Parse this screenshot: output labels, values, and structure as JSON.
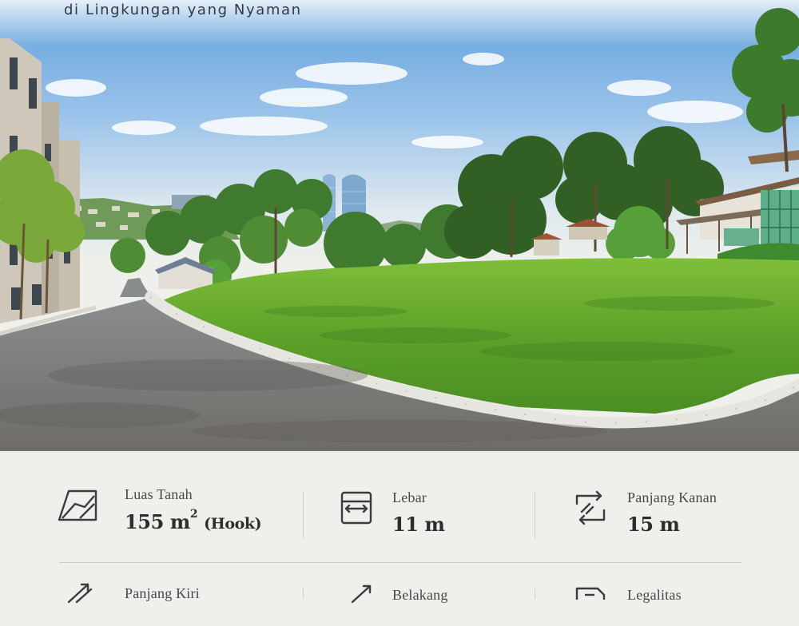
{
  "hero": {
    "subtitle": "di Lingkungan yang Nyaman",
    "illustration": "suburban-land-plot"
  },
  "specs": {
    "items": [
      {
        "icon": "land-area-icon",
        "label": "Luas Tanah",
        "value": "155 m",
        "sup": "2",
        "note": "(Hook)"
      },
      {
        "icon": "width-icon",
        "label": "Lebar",
        "value": "11 m"
      },
      {
        "icon": "right-length-icon",
        "label": "Panjang Kanan",
        "value": "15 m"
      },
      {
        "icon": "left-length-icon",
        "label": "Panjang Kiri"
      },
      {
        "icon": "back-icon",
        "label": "Belakang"
      },
      {
        "icon": "legal-document-icon",
        "label": "Legalitas"
      }
    ]
  }
}
